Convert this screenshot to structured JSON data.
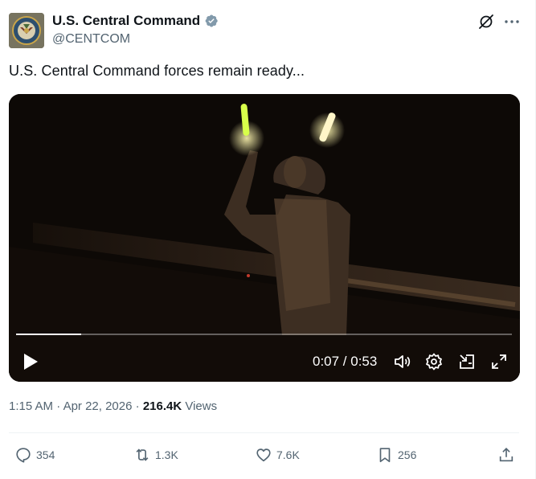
{
  "author": {
    "display_name": "U.S. Central Command",
    "handle": "@CENTCOM",
    "verified": true,
    "avatar": "centcom-seal"
  },
  "tweet": {
    "text": "U.S. Central Command forces remain ready..."
  },
  "video": {
    "current_time": "0:07",
    "duration": "0:53",
    "time_display": "0:07 / 0:53",
    "progress_fraction": 0.132,
    "controls": [
      "play-icon",
      "volume-icon",
      "settings-gear-icon",
      "pip-icon",
      "fullscreen-icon"
    ]
  },
  "meta": {
    "time": "1:15 AM",
    "separator": "·",
    "date": "Apr 22, 2026",
    "views_count": "216.4K",
    "views_label": "Views"
  },
  "actions": {
    "replies": "354",
    "reposts": "1.3K",
    "likes": "7.6K",
    "bookmarks": "256"
  },
  "colors": {
    "text_primary": "#0f1419",
    "text_secondary": "#536471",
    "verified": "#829aab",
    "divider": "#eff3f4"
  }
}
